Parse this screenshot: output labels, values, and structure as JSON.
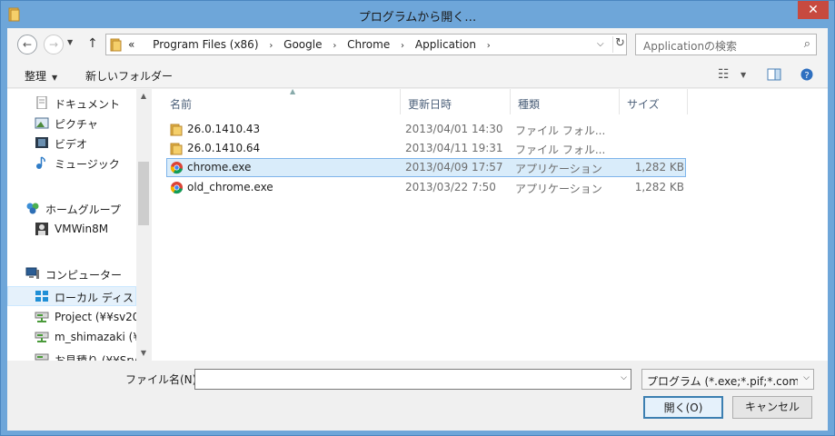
{
  "window": {
    "title": "プログラムから開く…",
    "close_glyph": "✕"
  },
  "address": {
    "prefix": "«",
    "crumbs": [
      "Program Files (x86)",
      "Google",
      "Chrome",
      "Application"
    ],
    "separator": "›"
  },
  "search": {
    "placeholder": "Applicationの検索"
  },
  "toolbar": {
    "organize": "整理",
    "new_folder": "新しいフォルダー"
  },
  "nav": {
    "items": [
      {
        "label": "ドキュメント",
        "icon": "documents-icon",
        "level": 1
      },
      {
        "label": "ピクチャ",
        "icon": "pictures-icon",
        "level": 1
      },
      {
        "label": "ビデオ",
        "icon": "videos-icon",
        "level": 1
      },
      {
        "label": "ミュージック",
        "icon": "music-icon",
        "level": 1
      },
      {
        "label": "ホームグループ",
        "icon": "homegroup-icon",
        "level": 0
      },
      {
        "label": "VMWin8M",
        "icon": "user-icon",
        "level": 1
      },
      {
        "label": "コンピューター",
        "icon": "computer-icon",
        "level": 0
      },
      {
        "label": "ローカル ディス",
        "icon": "local-disk-icon",
        "level": 1
      },
      {
        "label": "Project (¥¥sv20",
        "icon": "network-drive-icon",
        "level": 1
      },
      {
        "label": "m_shimazaki (¥",
        "icon": "network-drive-icon",
        "level": 1
      },
      {
        "label": "お見積り (¥¥Srv",
        "icon": "network-drive-icon",
        "level": 1
      }
    ]
  },
  "columns": {
    "name": "名前",
    "modified": "更新日時",
    "type": "種類",
    "size": "サイズ"
  },
  "files": [
    {
      "name": "26.0.1410.43",
      "modified": "2013/04/01 14:30",
      "type": "ファイル フォル...",
      "size": "",
      "icon": "folder-icon"
    },
    {
      "name": "26.0.1410.64",
      "modified": "2013/04/11 19:31",
      "type": "ファイル フォル...",
      "size": "",
      "icon": "folder-icon"
    },
    {
      "name": "chrome.exe",
      "modified": "2013/04/09 17:57",
      "type": "アプリケーション",
      "size": "1,282 KB",
      "icon": "chrome-icon"
    },
    {
      "name": "old_chrome.exe",
      "modified": "2013/03/22 7:50",
      "type": "アプリケーション",
      "size": "1,282 KB",
      "icon": "chrome-icon"
    }
  ],
  "bottom": {
    "filename_label": "ファイル名(N):",
    "filename_value": "",
    "filter": "プログラム (*.exe;*.pif;*.com;*",
    "open": "開く(O)",
    "cancel": "キャンセル"
  }
}
